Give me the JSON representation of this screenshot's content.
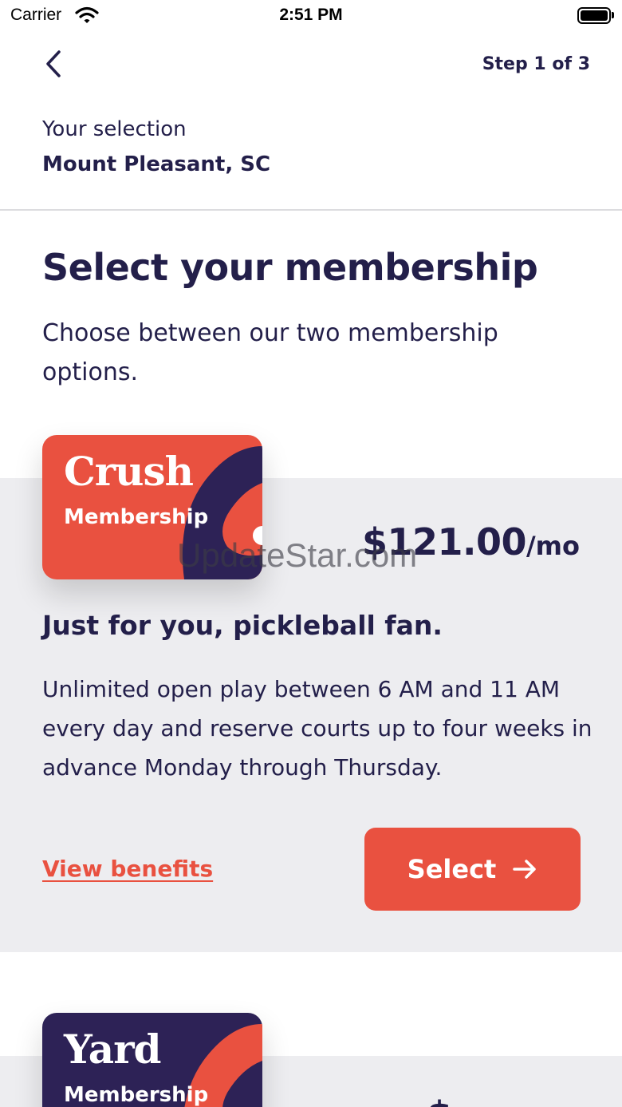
{
  "status_bar": {
    "carrier": "Carrier",
    "time": "2:51 PM",
    "wifi_icon": "wifi-icon",
    "battery_icon": "battery-icon"
  },
  "header": {
    "back_icon": "chevron-left-icon",
    "step": "Step 1 of 3",
    "selection_caption": "Your selection",
    "selection_value": "Mount Pleasant, SC"
  },
  "main": {
    "title": "Select your membership",
    "subtitle": "Choose between our two membership options."
  },
  "plans": [
    {
      "card_name": "Crush",
      "card_sub": "Membership",
      "price": "$121.00",
      "period": "/mo",
      "tagline": "Just for you, pickleball fan.",
      "description": "Unlimited open play between 6 AM and 11 AM every day and reserve courts up to four weeks in advance Monday through Thursday.",
      "benefits_link": "View benefits",
      "select_label": "Select",
      "select_icon": "arrow-right-icon",
      "card_color": "#e95140",
      "accent_color": "#2d2256"
    },
    {
      "card_name": "Yard",
      "card_sub": "Membership",
      "price_partial": "$",
      "card_color": "#2d2256",
      "accent_color": "#e95140"
    }
  ],
  "watermark": "UpdateStar.com",
  "colors": {
    "primary_text": "#231f4a",
    "accent": "#e95140",
    "panel_bg": "#ededf0"
  }
}
